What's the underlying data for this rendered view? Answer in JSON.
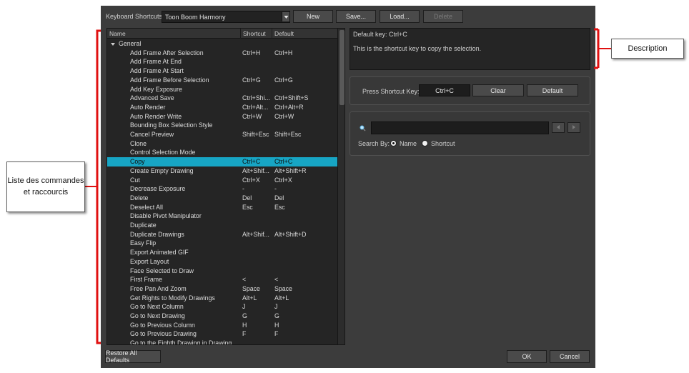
{
  "toolbar": {
    "label": "Keyboard Shortcuts:",
    "preset_value": "Toon Boom Harmony",
    "new_label": "New",
    "save_label": "Save...",
    "load_label": "Load...",
    "delete_label": "Delete"
  },
  "list": {
    "col_name": "Name",
    "col_shortcut": "Shortcut",
    "col_default": "Default",
    "group": "General",
    "rows": [
      {
        "name": "Add Frame After Selection",
        "shortcut": "Ctrl+H",
        "default": "Ctrl+H"
      },
      {
        "name": "Add Frame At End",
        "shortcut": "",
        "default": ""
      },
      {
        "name": "Add Frame At Start",
        "shortcut": "",
        "default": ""
      },
      {
        "name": "Add Frame Before Selection",
        "shortcut": "Ctrl+G",
        "default": "Ctrl+G"
      },
      {
        "name": "Add Key Exposure",
        "shortcut": "",
        "default": ""
      },
      {
        "name": "Advanced Save",
        "shortcut": "Ctrl+Shi...",
        "default": "Ctrl+Shift+S"
      },
      {
        "name": "Auto Render",
        "shortcut": "Ctrl+Alt...",
        "default": "Ctrl+Alt+R"
      },
      {
        "name": "Auto Render Write",
        "shortcut": "Ctrl+W",
        "default": "Ctrl+W"
      },
      {
        "name": "Bounding Box Selection Style",
        "shortcut": "",
        "default": ""
      },
      {
        "name": "Cancel Preview",
        "shortcut": "Shift+Esc",
        "default": "Shift+Esc"
      },
      {
        "name": "Clone",
        "shortcut": "",
        "default": ""
      },
      {
        "name": "Control Selection Mode",
        "shortcut": "",
        "default": ""
      },
      {
        "name": "Copy",
        "shortcut": "Ctrl+C",
        "default": "Ctrl+C",
        "selected": true
      },
      {
        "name": "Create Empty Drawing",
        "shortcut": "Alt+Shif...",
        "default": "Alt+Shift+R"
      },
      {
        "name": "Cut",
        "shortcut": "Ctrl+X",
        "default": "Ctrl+X"
      },
      {
        "name": "Decrease Exposure",
        "shortcut": "-",
        "default": "-"
      },
      {
        "name": "Delete",
        "shortcut": "Del",
        "default": "Del"
      },
      {
        "name": "Deselect All",
        "shortcut": "Esc",
        "default": "Esc"
      },
      {
        "name": "Disable Pivot Manipulator",
        "shortcut": "",
        "default": ""
      },
      {
        "name": "Duplicate",
        "shortcut": "",
        "default": ""
      },
      {
        "name": "Duplicate Drawings",
        "shortcut": "Alt+Shif...",
        "default": "Alt+Shift+D"
      },
      {
        "name": "Easy Flip",
        "shortcut": "",
        "default": ""
      },
      {
        "name": "Export Animated GIF",
        "shortcut": "",
        "default": ""
      },
      {
        "name": "Export Layout",
        "shortcut": "",
        "default": ""
      },
      {
        "name": "Face Selected to Draw",
        "shortcut": "",
        "default": ""
      },
      {
        "name": "First Frame",
        "shortcut": "<",
        "default": "<"
      },
      {
        "name": "Free Pan And Zoom",
        "shortcut": "Space",
        "default": "Space"
      },
      {
        "name": "Get Rights to Modify Drawings",
        "shortcut": "Alt+L",
        "default": "Alt+L"
      },
      {
        "name": "Go to Next Column",
        "shortcut": "J",
        "default": "J"
      },
      {
        "name": "Go to Next Drawing",
        "shortcut": "G",
        "default": "G"
      },
      {
        "name": "Go to Previous Column",
        "shortcut": "H",
        "default": "H"
      },
      {
        "name": "Go to Previous Drawing",
        "shortcut": "F",
        "default": "F"
      },
      {
        "name": "Go to the Eighth Drawing in Drawing",
        "shortcut": "",
        "default": ""
      }
    ]
  },
  "description": {
    "default_key": "Default key: Ctrl+C",
    "text": "This is the shortcut key to copy the selection."
  },
  "shortcut": {
    "label": "Press Shortcut Key:",
    "value": "Ctrl+C",
    "clear_label": "Clear",
    "default_label": "Default"
  },
  "search": {
    "value": "",
    "by_label": "Search By:",
    "opt_name": "Name",
    "opt_shortcut": "Shortcut",
    "selected": "Name"
  },
  "footer": {
    "restore_label": "Restore All Defaults",
    "ok_label": "OK",
    "cancel_label": "Cancel"
  },
  "callouts": {
    "list": "Liste des commandes et raccourcis",
    "description": "Description"
  },
  "colors": {
    "dialog_bg": "#3c3c3c",
    "selection": "#17a5c4",
    "annotation_red": "#e01010"
  }
}
